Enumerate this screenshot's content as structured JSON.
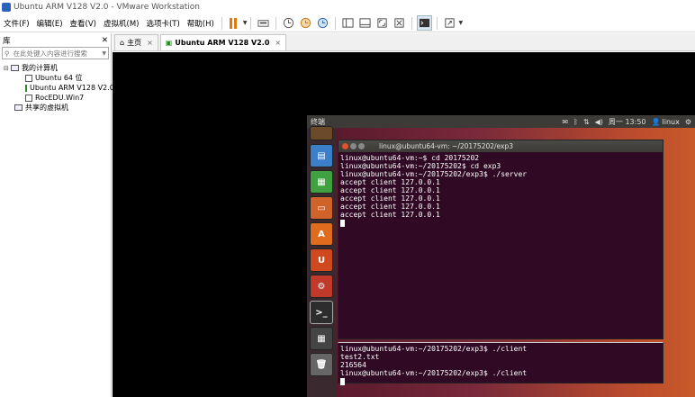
{
  "window": {
    "title": "Ubuntu ARM V128 V2.0 - VMware Workstation"
  },
  "menu": [
    "文件(F)",
    "编辑(E)",
    "查看(V)",
    "虚拟机(M)",
    "选项卡(T)",
    "帮助(H)"
  ],
  "library": {
    "title": "库",
    "search_placeholder": "在此处键入内容进行搜索",
    "tree": {
      "root": "我的计算机",
      "vms": [
        "Ubuntu 64 位",
        "Ubuntu ARM V128 V2.0",
        "RocEDU.Win7"
      ],
      "shared": "共享的虚拟机"
    }
  },
  "tabs": [
    {
      "label": "主页",
      "active": false
    },
    {
      "label": "Ubuntu ARM V128 V2.0",
      "active": true
    }
  ],
  "ubuntu": {
    "topbar_title": "终端",
    "clock": "周一 13:50",
    "user": "linux",
    "terminal1": {
      "title": "linux@ubuntu64-vm: ~/20175202/exp3",
      "lines": [
        "linux@ubuntu64-vm:~$ cd 20175202",
        "linux@ubuntu64-vm:~/20175202$ cd exp3",
        "linux@ubuntu64-vm:~/20175202/exp3$ ./server",
        "accept client 127.0.0.1",
        "accept client 127.0.0.1",
        "accept client 127.0.0.1",
        "accept client 127.0.0.1",
        "accept client 127.0.0.1"
      ]
    },
    "terminal2": {
      "lines": [
        "linux@ubuntu64-vm:~/20175202/exp3$ ./client",
        "test2.txt",
        "216564",
        "linux@ubuntu64-vm:~/20175202/exp3$ ./client"
      ]
    }
  }
}
